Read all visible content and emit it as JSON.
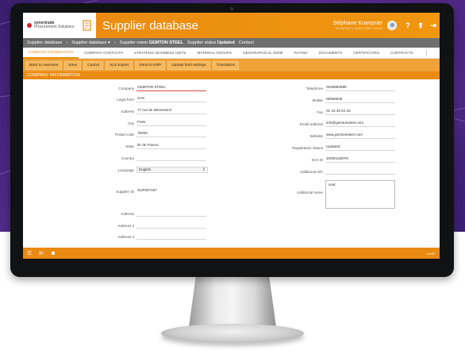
{
  "header": {
    "logo_brand": "synertrade",
    "logo_tag": "Procurement Solutions",
    "title": "Supplier database",
    "user_name": "Stéphane Krampner",
    "user_date": "29.06.2017 | 15:52 | GMT +02:00",
    "help": "?",
    "settings": "⬆",
    "logout": "⇥"
  },
  "breadcrumb": {
    "item1": "Supplier database",
    "item2": "Supplier database ▾",
    "item3_label": "Supplier name",
    "item3_value": "GEMTON STEEL",
    "item4_label": "Supplier status",
    "item4_value": "Updated",
    "item5": "Contact"
  },
  "tabs": [
    "COMPANY INFORMATION",
    "COMPANY CONTACTS",
    "STRATEGIC BUSINESS UNITS",
    "MATERIAL GROUPS",
    "GEOGRAPHICAL ZONE",
    "RATING",
    "DOCUMENTS",
    "CERTIFICATES",
    "CONTRACTS"
  ],
  "tab_more": "⋮",
  "toolbar": [
    "Back to overview",
    "Save",
    "Cancel",
    "XLS Export",
    "Send to ERP",
    "Update field settings",
    "Translation"
  ],
  "section_title": "COMPANY INFORMATION",
  "left_fields": {
    "company": {
      "label": "Company",
      "value": "GEMTON STEEL"
    },
    "legal_form": {
      "label": "Legal form",
      "value": "SAS"
    },
    "address": {
      "label": "Address",
      "value": "77 rue de Miromesnil"
    },
    "city": {
      "label": "City",
      "value": "Paris"
    },
    "postal_code": {
      "label": "Postal code",
      "value": "75008"
    },
    "state": {
      "label": "State",
      "value": "Ile de France"
    },
    "country": {
      "label": "Country",
      "value": ""
    },
    "language": {
      "label": "Language",
      "value": "English"
    },
    "supplier_id": {
      "label": "Supplier ID",
      "value": "SUP007187"
    },
    "address2": {
      "label": "Address",
      "value": ""
    },
    "address3": {
      "label": "Address 3",
      "value": ""
    },
    "address4": {
      "label": "Address 4",
      "value": ""
    }
  },
  "right_fields": {
    "telephone": {
      "label": "Telephone",
      "value": "0156982999"
    },
    "mobile": {
      "label": "Mobile",
      "value": "06568525"
    },
    "fax": {
      "label": "Fax",
      "value": "01 43 45 54 33"
    },
    "email": {
      "label": "Email address",
      "value": "info@gemtonsteel.com"
    },
    "website": {
      "label": "Website",
      "value": "www.gemtonsteel.com"
    },
    "registration_status": {
      "label": "Registration Status",
      "value": "Updated"
    },
    "erp_id": {
      "label": "ErO ID",
      "value": "10000118076"
    },
    "additional_info": {
      "label": "Additional Info",
      "value": ""
    },
    "additional_name": {
      "label": "Additional name",
      "value": "voet"
    }
  },
  "footer": {
    "menu_icon": "☰",
    "linkedin_icon": "in",
    "rss_icon": "◙",
    "version": "4.14P"
  }
}
